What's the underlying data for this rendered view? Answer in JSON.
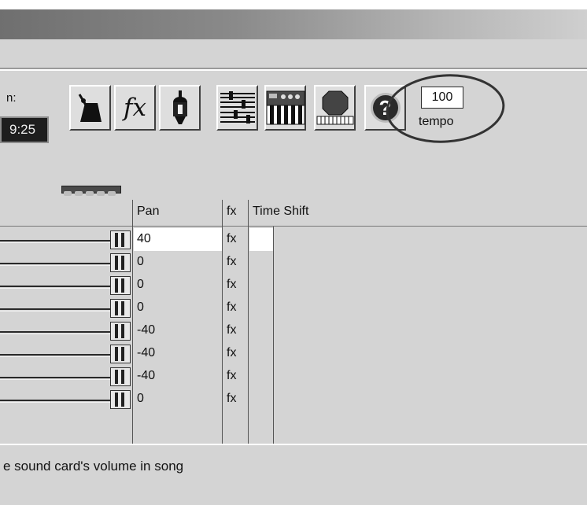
{
  "toolbar": {
    "time_label": "n:",
    "time_value": "9:25",
    "buttons": [
      {
        "name": "metronome",
        "icon": "metronome-icon"
      },
      {
        "name": "effects",
        "icon": "fx-icon",
        "label": "fx"
      },
      {
        "name": "microphone",
        "icon": "microphone-icon"
      },
      {
        "name": "mixer",
        "icon": "mixer-icon"
      },
      {
        "name": "keyboard",
        "icon": "keyboard-icon"
      },
      {
        "name": "stop",
        "icon": "stop-keyboard-icon"
      },
      {
        "name": "help",
        "icon": "help-icon",
        "label": "?"
      }
    ],
    "tempo": {
      "value": "100",
      "label": "tempo"
    }
  },
  "track_grid": {
    "columns": {
      "pan": "Pan",
      "fx": "fx",
      "time_shift": "Time Shift"
    },
    "rows": [
      {
        "pan": "40",
        "fx": "fx"
      },
      {
        "pan": "0",
        "fx": "fx"
      },
      {
        "pan": "0",
        "fx": "fx"
      },
      {
        "pan": "0",
        "fx": "fx"
      },
      {
        "pan": "-40",
        "fx": "fx"
      },
      {
        "pan": "-40",
        "fx": "fx"
      },
      {
        "pan": "-40",
        "fx": "fx"
      },
      {
        "pan": "0",
        "fx": "fx"
      }
    ]
  },
  "statusbar": {
    "text": "e sound card's volume in song"
  },
  "colors": {
    "chrome": "#d4d4d4",
    "annotation": "#333333",
    "display_bg": "#1e1e1e"
  }
}
